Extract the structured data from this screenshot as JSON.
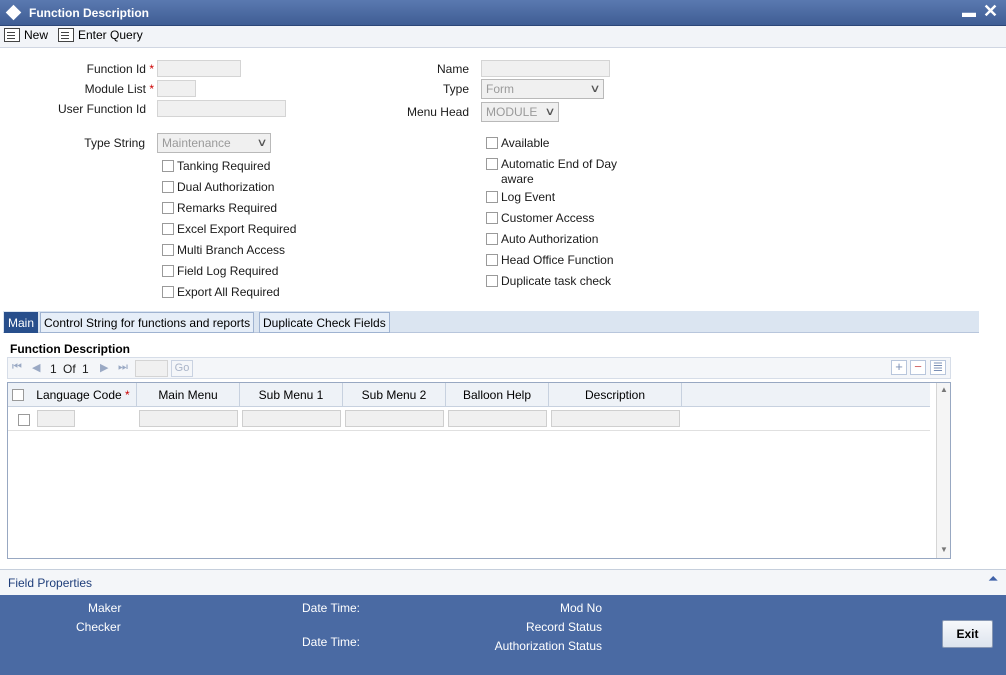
{
  "window": {
    "title": "Function Description"
  },
  "toolbar": {
    "new_label": "New",
    "enter_query_label": "Enter Query"
  },
  "form": {
    "function_id_label": "Function Id",
    "module_list_label": "Module List",
    "user_function_id_label": "User Function Id",
    "name_label": "Name",
    "type_label": "Type",
    "type_value": "Form",
    "menu_head_label": "Menu Head",
    "menu_head_value": "MODULE",
    "type_string_label": "Type String",
    "type_string_value": "Maintenance",
    "required_marker": "*"
  },
  "left_checkboxes": [
    "Tanking Required",
    "Dual Authorization",
    "Remarks Required",
    "Excel Export Required",
    "Multi Branch Access",
    "Field Log Required",
    "Export All Required"
  ],
  "right_checkboxes": [
    "Available",
    "Automatic End of Day aware",
    "Log Event",
    "Customer Access",
    "Auto Authorization",
    "Head Office Function",
    "Duplicate task check"
  ],
  "tabs": [
    "Main",
    "Control String for functions and reports",
    "Duplicate Check Fields"
  ],
  "section": {
    "title": "Function Description"
  },
  "pager": {
    "current": "1",
    "of_label": "Of",
    "total": "1",
    "go_label": "Go"
  },
  "grid": {
    "columns": [
      "Language Code",
      "Main Menu",
      "Sub Menu 1",
      "Sub Menu 2",
      "Balloon Help",
      "Description"
    ]
  },
  "field_properties_label": "Field Properties",
  "footer": {
    "maker_label": "Maker",
    "checker_label": "Checker",
    "date_time_label": "Date Time:",
    "mod_no_label": "Mod No",
    "record_status_label": "Record Status",
    "authorization_status_label": "Authorization Status",
    "exit_label": "Exit"
  }
}
